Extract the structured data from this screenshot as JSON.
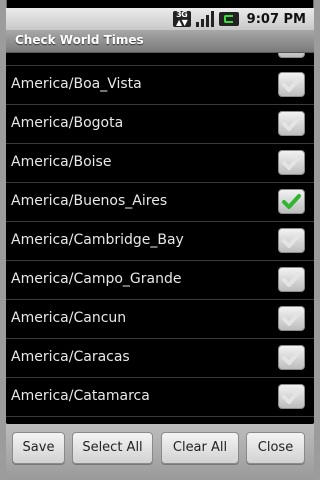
{
  "status_bar": {
    "network_type": "3G",
    "time": "9:07 PM"
  },
  "app": {
    "title": "Check World Times"
  },
  "list": {
    "items": [
      {
        "label": "America/Boa_Vista",
        "checked": false
      },
      {
        "label": "America/Bogota",
        "checked": false
      },
      {
        "label": "America/Boise",
        "checked": false
      },
      {
        "label": "America/Buenos_Aires",
        "checked": true
      },
      {
        "label": "America/Cambridge_Bay",
        "checked": false
      },
      {
        "label": "America/Campo_Grande",
        "checked": false
      },
      {
        "label": "America/Cancun",
        "checked": false
      },
      {
        "label": "America/Caracas",
        "checked": false
      },
      {
        "label": "America/Catamarca",
        "checked": false
      }
    ]
  },
  "buttons": {
    "save": "Save",
    "select_all": "Select All",
    "clear_all": "Clear All",
    "close": "Close"
  },
  "colors": {
    "check_checked": "#2fb52f",
    "check_unchecked": "#e4e4e4"
  },
  "icons": [
    "network-3g-icon",
    "signal-icon",
    "battery-icon",
    "checkbox-icon",
    "checkmark-icon"
  ]
}
